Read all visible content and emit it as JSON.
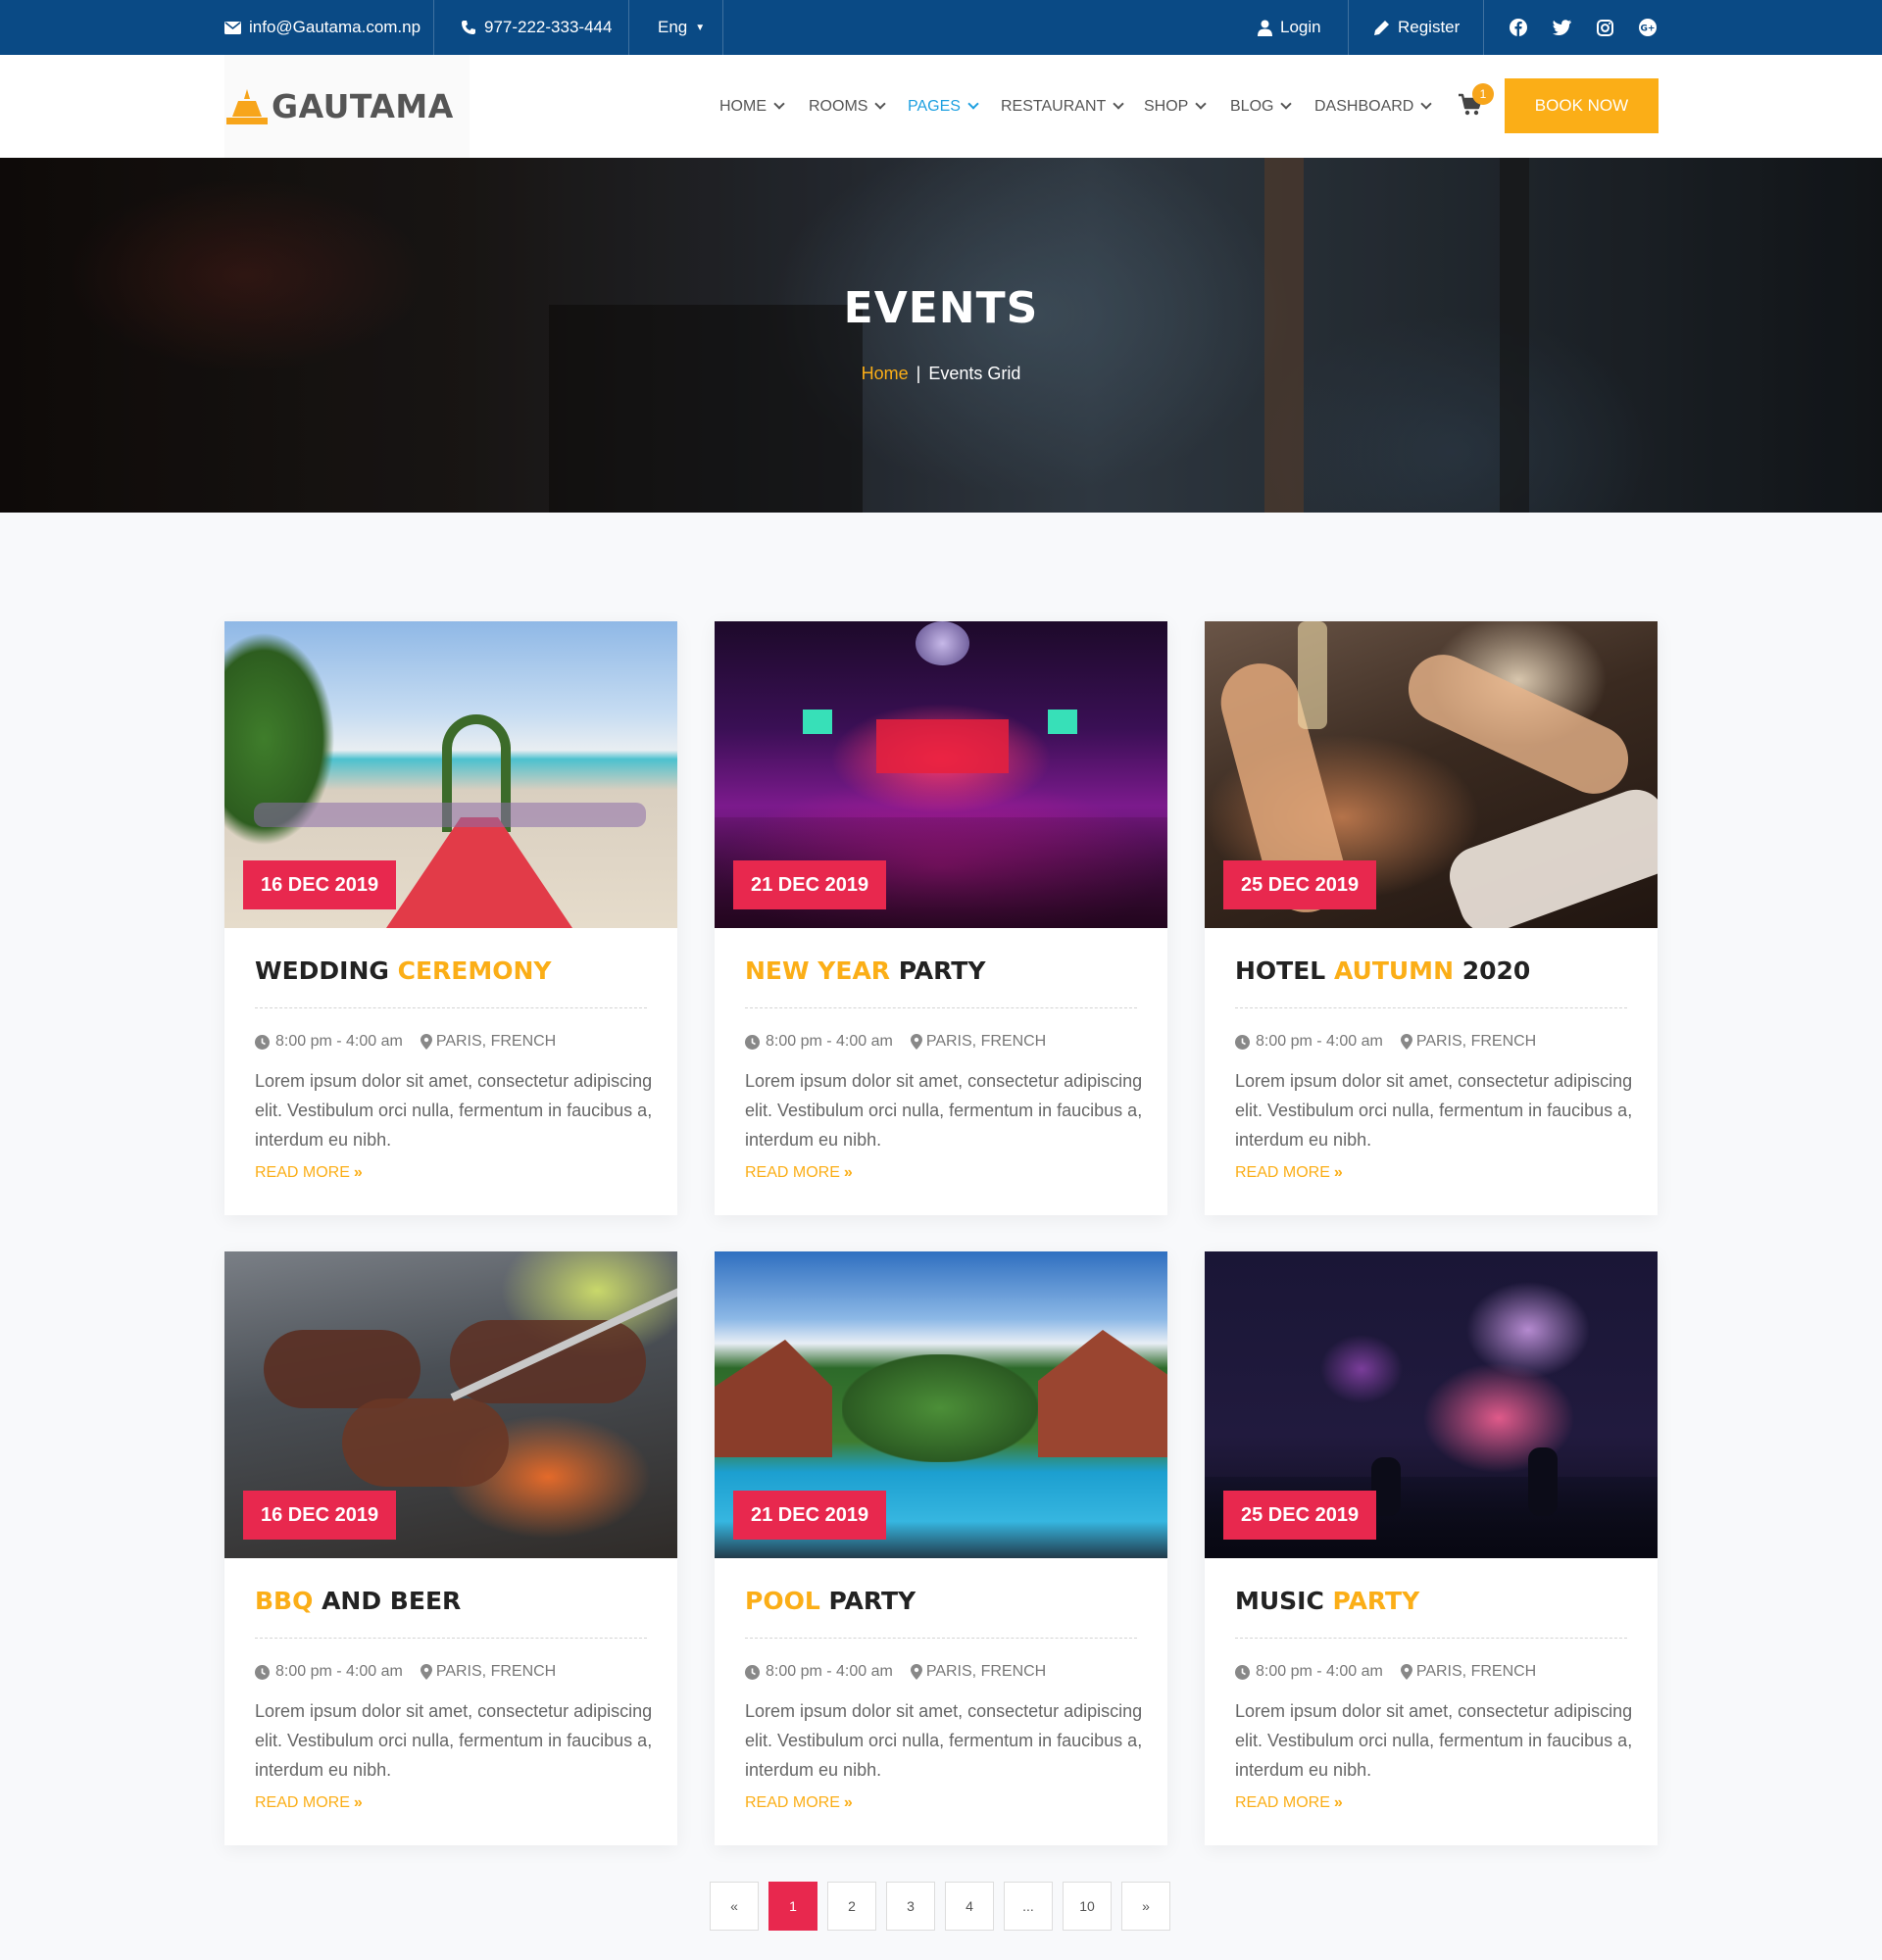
{
  "topbar": {
    "email": "info@Gautama.com.np",
    "phone": "977-222-333-444",
    "language": "Eng",
    "login": "Login",
    "register": "Register"
  },
  "brand": {
    "name": "GAUTAMA"
  },
  "nav": {
    "items": [
      "HOME",
      "ROOMS",
      "PAGES",
      "RESTAURANT",
      "SHOP",
      "BLOG",
      "DASHBOARD"
    ],
    "active": "PAGES",
    "cart_count": "1",
    "book_now": "BOOK NOW"
  },
  "hero": {
    "title": "EVENTS",
    "breadcrumb_home": "Home",
    "breadcrumb_sep": "|",
    "breadcrumb_current": "Events Grid"
  },
  "events": [
    {
      "date": "16 DEC 2019",
      "title_a": "WEDDING ",
      "title_b": "CEREMONY",
      "title_c": "",
      "time": "8:00 pm - 4:00 am",
      "location": "PARIS, FRENCH",
      "text": "Lorem ipsum dolor sit amet, consectetur adipiscing elit. Vestibulum orci nulla, fermentum in faucibus a, interdum eu nibh.",
      "read_more": "READ MORE"
    },
    {
      "date": "21 DEC 2019",
      "title_a": "",
      "title_b": "NEW YEAR",
      "title_c": " PARTY",
      "time": "8:00 pm - 4:00 am",
      "location": "PARIS, FRENCH",
      "text": "Lorem ipsum dolor sit amet, consectetur adipiscing elit. Vestibulum orci nulla, fermentum in faucibus a, interdum eu nibh.",
      "read_more": "READ MORE"
    },
    {
      "date": "25 DEC 2019",
      "title_a": "HOTEL ",
      "title_b": "AUTUMN",
      "title_c": " 2020",
      "time": "8:00 pm - 4:00 am",
      "location": "PARIS, FRENCH",
      "text": "Lorem ipsum dolor sit amet, consectetur adipiscing elit. Vestibulum orci nulla, fermentum in faucibus a, interdum eu nibh.",
      "read_more": "READ MORE"
    },
    {
      "date": "16 DEC 2019",
      "title_a": "",
      "title_b": "BBQ",
      "title_c": " AND BEER",
      "time": "8:00 pm - 4:00 am",
      "location": "PARIS, FRENCH",
      "text": "Lorem ipsum dolor sit amet, consectetur adipiscing elit. Vestibulum orci nulla, fermentum in faucibus a, interdum eu nibh.",
      "read_more": "READ MORE"
    },
    {
      "date": "21 DEC 2019",
      "title_a": "",
      "title_b": "POOL",
      "title_c": " PARTY",
      "time": "8:00 pm - 4:00 am",
      "location": "PARIS, FRENCH",
      "text": "Lorem ipsum dolor sit amet, consectetur adipiscing elit. Vestibulum orci nulla, fermentum in faucibus a, interdum eu nibh.",
      "read_more": "READ MORE"
    },
    {
      "date": "25 DEC 2019",
      "title_a": "MUSIC ",
      "title_b": "PARTY",
      "title_c": "",
      "time": "8:00 pm - 4:00 am",
      "location": "PARIS, FRENCH",
      "text": "Lorem ipsum dolor sit amet, consectetur adipiscing elit. Vestibulum orci nulla, fermentum in faucibus a, interdum eu nibh.",
      "read_more": "READ MORE"
    }
  ],
  "pagination": {
    "prev": "«",
    "pages": [
      "1",
      "2",
      "3",
      "4",
      "...",
      "10"
    ],
    "active": "1",
    "next": "»"
  },
  "colors": {
    "topbar": "#0a4a85",
    "accent": "#fbae17",
    "date_badge": "#e8284e",
    "nav_active": "#1ea0e0"
  },
  "icons": [
    "envelope-icon",
    "phone-icon",
    "user-icon",
    "pencil-icon",
    "facebook-icon",
    "twitter-icon",
    "instagram-icon",
    "google-plus-icon",
    "cart-icon",
    "clock-icon",
    "map-marker-icon",
    "double-chevron-right-icon"
  ]
}
